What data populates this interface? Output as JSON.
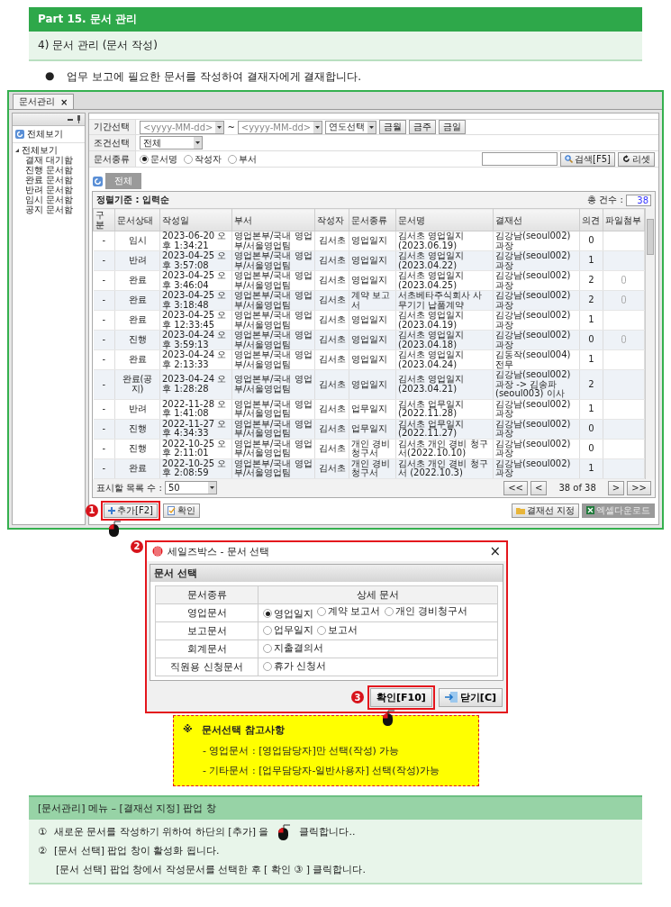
{
  "part_header": {
    "title": "Part 15. 문서 관리"
  },
  "section_header": {
    "title": "4) 문서 관리 (문서 작성)"
  },
  "intro": {
    "bullet": "●",
    "text": "업무 보고에 필요한 문서를 작성하여 결재자에게 결재합니다."
  },
  "app": {
    "tab": {
      "label": "문서관리",
      "close": "×"
    },
    "sidebar": {
      "header_item": "전체보기",
      "tree": [
        {
          "label": "전체보기",
          "expanded": true,
          "children": [
            {
              "label": "결재 대기함"
            },
            {
              "label": "진행 문서함"
            },
            {
              "label": "완료 문서함"
            },
            {
              "label": "반려 문서함"
            },
            {
              "label": "임시 문서함"
            },
            {
              "label": "공지 문서함"
            }
          ]
        }
      ]
    },
    "filters": {
      "period": {
        "label": "기간선택",
        "start_placeholder": "<yyyy-MM-dd>",
        "separator": "~",
        "end_placeholder": "<yyyy-MM-dd>",
        "year_select": "연도선택",
        "buttons": [
          "금월",
          "금주",
          "금일"
        ]
      },
      "condition": {
        "label": "조건선택",
        "value": "전체"
      },
      "doc_type": {
        "label": "문서종류",
        "options": [
          {
            "label": "문서명",
            "selected": true
          },
          {
            "label": "작성자",
            "selected": false
          },
          {
            "label": "부서",
            "selected": false
          }
        ]
      },
      "search_button": "검색[F5]",
      "reset_button": "리셋"
    },
    "view_tabs": [
      {
        "label": "전체",
        "selected": true
      }
    ],
    "sort_label": "정렬기준 : 입력순",
    "total": {
      "label": "총 건수 :",
      "value": "38"
    },
    "table": {
      "columns": [
        "구분",
        "문서상태",
        "작성일",
        "부서",
        "작성자",
        "문서종류",
        "문서명",
        "결재선",
        "의견",
        "파일첨부"
      ],
      "rows": [
        {
          "cells": [
            "-",
            "임시",
            "2023-06-20 오후 1:34:21",
            "영업본부/국내 영업부/서울영업팀",
            "김서초",
            "영업일지",
            "김서초 영업일지 (2023.06.19)",
            "김강남(seoul002) 과장",
            "0"
          ],
          "attachment": false
        },
        {
          "cells": [
            "-",
            "반려",
            "2023-04-25 오후 3:57:08",
            "영업본부/국내 영업부/서울영업팀",
            "김서초",
            "영업일지",
            "김서초 영업일지 (2023.04.22)",
            "김강남(seoul002) 과장",
            "1"
          ],
          "attachment": false
        },
        {
          "cells": [
            "-",
            "완료",
            "2023-04-25 오후 3:46:04",
            "영업본부/국내 영업부/서울영업팀",
            "김서초",
            "영업일지",
            "김서초 영업일지 (2023.04.25)",
            "김강남(seoul002) 과장",
            "2"
          ],
          "attachment": true
        },
        {
          "cells": [
            "-",
            "완료",
            "2023-04-25 오후 3:18:48",
            "영업본부/국내 영업부/서울영업팀",
            "김서초",
            "계약 보고서",
            "서초베타주식회사 사무기기 납품계약",
            "김강남(seoul002) 과장",
            "2"
          ],
          "attachment": true
        },
        {
          "cells": [
            "-",
            "완료",
            "2023-04-25 오후 12:33:45",
            "영업본부/국내 영업부/서울영업팀",
            "김서초",
            "영업일지",
            "김서초 영업일지 (2023.04.19)",
            "김강남(seoul002) 과장",
            "1"
          ],
          "attachment": false
        },
        {
          "cells": [
            "-",
            "진행",
            "2023-04-24 오후 3:59:13",
            "영업본부/국내 영업부/서울영업팀",
            "김서초",
            "영업일지",
            "김서초 영업일지 (2023.04.18)",
            "김강남(seoul002) 과장",
            "0"
          ],
          "attachment": true
        },
        {
          "cells": [
            "-",
            "완료",
            "2023-04-24 오후 2:13:33",
            "영업본부/국내 영업부/서울영업팀",
            "김서초",
            "영업일지",
            "김서초 영업일지 (2023.04.24)",
            "김동작(seoul004) 전무",
            "1"
          ],
          "attachment": false
        },
        {
          "cells": [
            "-",
            "완료(공지)",
            "2023-04-24 오후 1:28:28",
            "영업본부/국내 영업부/서울영업팀",
            "김서초",
            "영업일지",
            "김서초 영업일지 (2023.04.21)",
            "김강남(seoul002) 과장 -> 김송파(seoul003) 이사",
            "2"
          ],
          "attachment": false
        },
        {
          "cells": [
            "-",
            "반려",
            "2022-11-28 오후 1:41:08",
            "영업본부/국내 영업부/서울영업팀",
            "김서초",
            "업무일지",
            "김서초 업무일지 (2022.11.28)",
            "김강남(seoul002) 과장",
            "1"
          ],
          "attachment": false
        },
        {
          "cells": [
            "-",
            "진행",
            "2022-11-27 오후 4:34:33",
            "영업본부/국내 영업부/서울영업팀",
            "김서초",
            "업무일지",
            "김서초 업무일지 (2022.11.27)",
            "김강남(seoul002) 과장",
            "0"
          ],
          "attachment": false
        },
        {
          "cells": [
            "-",
            "진행",
            "2022-10-25 오후 2:11:01",
            "영업본부/국내 영업부/서울영업팀",
            "김서초",
            "개인 경비 청구서",
            "김서초 개인 경비 청구서(2022.10.10)",
            "김강남(seoul002) 과장",
            "0"
          ],
          "attachment": false
        },
        {
          "cells": [
            "-",
            "완료",
            "2022-10-25 오후 2:08:59",
            "영업본부/국내 영업부/서울영업팀",
            "김서초",
            "개인 경비 청구서",
            "김서초 개인 경비 청구서 (2022.10.3)",
            "김강남(seoul002) 과장",
            "1"
          ],
          "attachment": false
        }
      ]
    },
    "page_size": {
      "label": "표시할 목록 수 :",
      "value": "50"
    },
    "pager": {
      "first": "<<",
      "prev": "<",
      "info": "38 of 38",
      "next": ">",
      "last": ">>"
    },
    "add_button": {
      "label": "추가[F2]",
      "marker": "1"
    },
    "confirm_button": {
      "label": "확인"
    },
    "approval_line_button": {
      "label": "결재선 지정",
      "disabled": false
    },
    "excel_button": {
      "label": "엑셀다운로드",
      "disabled": true
    }
  },
  "dialog": {
    "marker": "2",
    "title": "세일즈박스 - 문서 선택",
    "close": "×",
    "section": "문서 선택",
    "columns": [
      "문서종류",
      "상세 문서"
    ],
    "rows": [
      {
        "category": "영업문서",
        "options": [
          {
            "label": "영업일지",
            "selected": true
          },
          {
            "label": "계약 보고서",
            "selected": false
          },
          {
            "label": "개인 경비청구서",
            "selected": false
          }
        ]
      },
      {
        "category": "보고문서",
        "options": [
          {
            "label": "업무일지",
            "selected": false
          },
          {
            "label": "보고서",
            "selected": false
          }
        ]
      },
      {
        "category": "회계문서",
        "options": [
          {
            "label": "지출결의서",
            "selected": false
          }
        ]
      },
      {
        "category": "직원용 신청문서",
        "options": [
          {
            "label": "휴가 신청서",
            "selected": false
          }
        ]
      }
    ],
    "ok_button": {
      "label": "확인[F10]",
      "marker": "3"
    },
    "close_button": {
      "label": "닫기[C]"
    }
  },
  "note": {
    "mark": "※",
    "title": "문서선택 참고사항",
    "lines": [
      "- 영업문서 : [영업담당자]만 선택(작성) 가능",
      "- 기타문서 : [업무담당자-일반사용자] 선택(작성)가능"
    ]
  },
  "guide": {
    "header": "[문서관리] 메뉴 – [결재선 지정] 팝업 창",
    "steps": [
      {
        "number": "①",
        "text": "새로운 문서를 작성하기 위하여 하단의  [추가] 을",
        "after_icon": "클릭합니다.."
      },
      {
        "number": "②",
        "text": "[문서 선택]  팝업 창이 활성화 됩니다."
      },
      {
        "text": "[문서 선택] 팝업 창에서  작성문서를 선택한 후 [ 확인 ③ ]  클릭합니다."
      }
    ]
  }
}
